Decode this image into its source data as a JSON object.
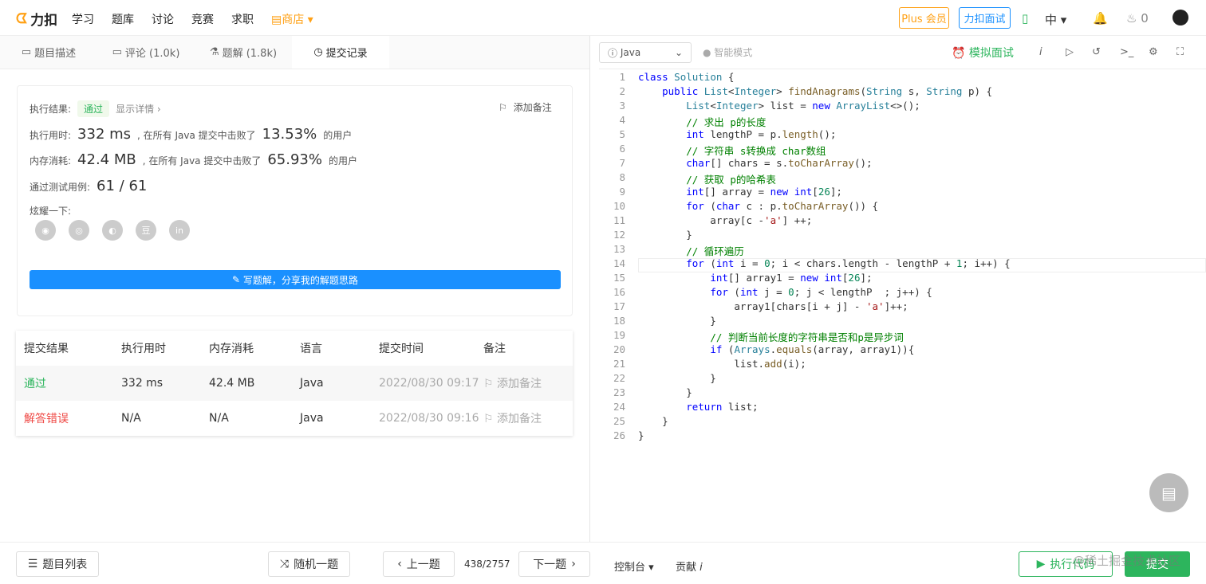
{
  "nav": {
    "logo": "力扣",
    "items": [
      "学习",
      "题库",
      "讨论",
      "竞赛",
      "求职"
    ],
    "shop": "商店",
    "plus": "Plus 会员",
    "interview": "力扣面试",
    "lang": "中",
    "count": "0"
  },
  "tabs": [
    "题目描述",
    "评论 (1.0k)",
    "题解 (1.8k)",
    "提交记录"
  ],
  "result": {
    "label": "执行结果:",
    "status": "通过",
    "detail": "显示详情 ›",
    "note": "添加备注",
    "time_label": "执行用时:",
    "time": "332 ms",
    "time_text": ", 在所有 Java 提交中击败了",
    "time_pct": "13.53%",
    "users": "的用户",
    "mem_label": "内存消耗:",
    "mem": "42.4 MB",
    "mem_text": ", 在所有 Java 提交中击败了",
    "mem_pct": "65.93%",
    "cases_label": "通过测试用例:",
    "cases": "61 / 61",
    "share": "炫耀一下:",
    "write": "写题解，分享我的解题思路"
  },
  "table": {
    "headers": [
      "提交结果",
      "执行用时",
      "内存消耗",
      "语言",
      "提交时间",
      "备注"
    ],
    "rows": [
      [
        "通过",
        "332 ms",
        "42.4 MB",
        "Java",
        "2022/08/30 09:17",
        "添加备注"
      ],
      [
        "解答错误",
        "N/A",
        "N/A",
        "Java",
        "2022/08/30 09:16",
        "添加备注"
      ]
    ]
  },
  "editor": {
    "lang": "Java",
    "mode": "智能模式",
    "mock": "模拟面试"
  },
  "bottom": {
    "list": "题目列表",
    "random": "随机一题",
    "prev": "上一题",
    "page": "438/2757",
    "next": "下一题",
    "console": "控制台",
    "contrib": "贡献",
    "run": "执行代码",
    "submit": "提交",
    "watermark": "@稀土掘金技术社区"
  }
}
